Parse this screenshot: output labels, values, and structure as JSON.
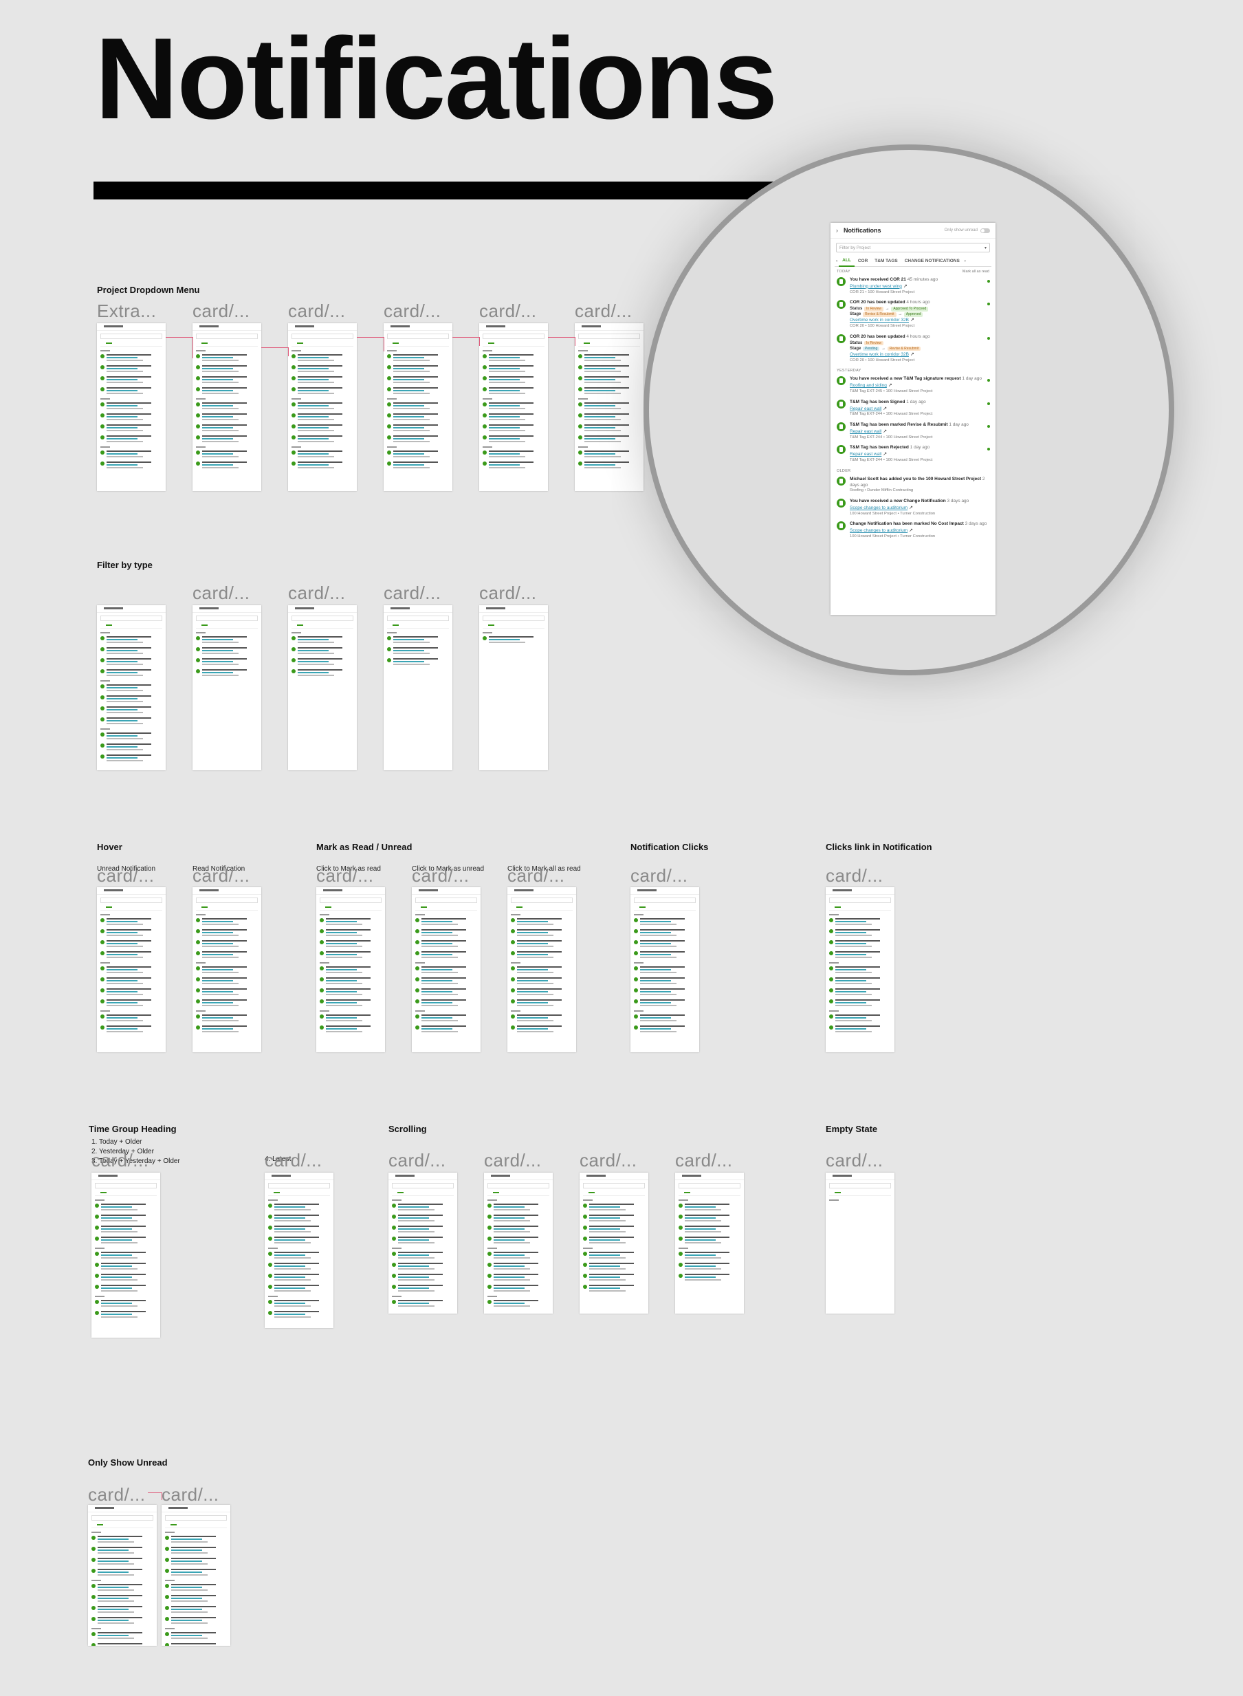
{
  "page": {
    "title": "Notifications"
  },
  "sections": {
    "project_dropdown": "Project Dropdown Menu",
    "filter_type": "Filter by type",
    "hover": "Hover",
    "mark_read": "Mark as Read / Unread",
    "notification_clicks": "Notification Clicks",
    "clicks_link": "Clicks link in Notification",
    "time_group": "Time Group Heading",
    "scrolling": "Scrolling",
    "empty_state": "Empty State",
    "only_unread": "Only Show Unread"
  },
  "sublabels": {
    "unread_notification": "Unread Notification",
    "read_notification": "Read Notification",
    "click_mark_read": "Click to Mark as read",
    "click_mark_unread": "Click to Mark as unread",
    "click_mark_all": "Click to Mark all as read",
    "time_group_list": [
      "1. Today + Older",
      "2. Yesterday + Older",
      "3. Today + Yesterday + Older"
    ],
    "latest": "4. Latest"
  },
  "card_labels": {
    "extra": "Extra...",
    "card": "card/..."
  },
  "panel": {
    "title": "Notifications",
    "only_unread": "Only show unread",
    "filter_placeholder": "Filter by Project",
    "tabs": [
      "ALL",
      "COR",
      "T&M TAGS",
      "CHANGE NOTIFICATIONS"
    ],
    "mark_all": "Mark all as read",
    "groups": {
      "today": "TODAY",
      "yesterday": "YESTERDAY",
      "older": "OLDER"
    },
    "today": [
      {
        "title": "You have received COR 21",
        "ago": "45 minutes ago",
        "link": "Plumbing under west wing",
        "meta": "COR 21 • 100 Howard Street Project"
      },
      {
        "title": "COR 20 has been updated",
        "ago": "4 hours ago",
        "status_label": "Status",
        "status_from": "In Review",
        "status_to": "Approved To Proceed",
        "stage_label": "Stage",
        "stage_from": "Revise & Resubmit",
        "stage_to": "Approved",
        "link": "Overtime work in corridor 32B",
        "meta": "COR 20 • 100 Howard Street Project"
      },
      {
        "title": "COR 20 has been updated",
        "ago": "4 hours ago",
        "status_label": "Status",
        "status_to": "In Review",
        "stage_label": "Stage",
        "stage_from": "Pending",
        "stage_to": "Revise & Resubmit",
        "link": "Overtime work in corridor 32B",
        "meta": "COR 20 • 100 Howard Street Project"
      }
    ],
    "yesterday": [
      {
        "title": "You have received a new T&M Tag signature request",
        "ago": "1 day ago",
        "link": "Roofing and siding",
        "meta": "T&M Tag EXT-245 • 100 Howard Street Project"
      },
      {
        "title": "T&M Tag has been Signed",
        "ago": "1 day ago",
        "link": "Repair east wall",
        "meta": "T&M Tag EXT-244 • 100 Howard Street Project"
      },
      {
        "title": "T&M Tag has been marked Revise & Resubmit",
        "ago": "1 day ago",
        "link": "Repair east wall",
        "meta": "T&M Tag EXT-244 • 100 Howard Street Project"
      },
      {
        "title": "T&M Tag has been Rejected",
        "ago": "1 day ago",
        "link": "Repair east wall",
        "meta": "T&M Tag EXT-244 • 100 Howard Street Project"
      }
    ],
    "older": [
      {
        "title": "Michael Scott has added you to the 100 Howard Street Project",
        "ago": "2 days ago",
        "meta": "Roofing • Dunder Mifflin Contracting"
      },
      {
        "title": "You have received a new Change Notification",
        "ago": "3 days ago",
        "link": "Scope changes to auditorium",
        "meta": "100 Howard Street Project • Turner Construction"
      },
      {
        "title": "Change Notification has been marked No Cost Impact",
        "ago": "3 days ago",
        "link": "Scope changes to auditorium",
        "meta": "100 Howard Street Project • Turner Construction"
      }
    ]
  },
  "icons": {
    "back": "chevron-right-icon",
    "notification": "document-icon",
    "external": "external-link-icon"
  },
  "colors": {
    "accent": "#3a9a1a",
    "link": "#2a8fb0",
    "background": "#e6e6e6"
  }
}
